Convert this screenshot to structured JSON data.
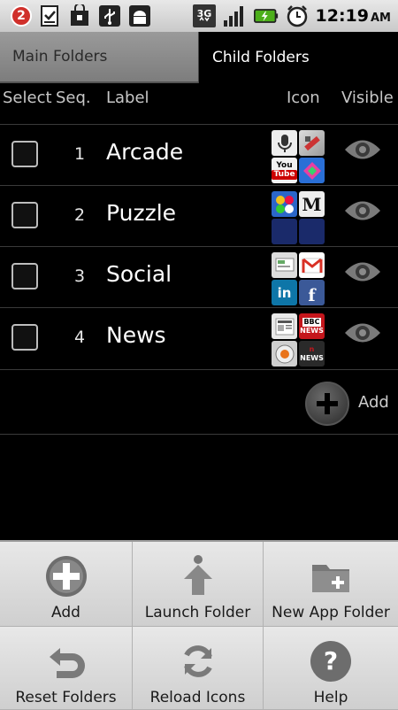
{
  "status_bar": {
    "notification_count": "2",
    "network": "3G",
    "time": "12:19",
    "ampm": "AM"
  },
  "tabs": [
    {
      "label": "Main Folders",
      "active": false
    },
    {
      "label": "Child Folders",
      "active": true
    }
  ],
  "table": {
    "headers": {
      "select": "Select",
      "seq": "Seq.",
      "label": "Label",
      "icon": "Icon",
      "visible": "Visible"
    },
    "rows": [
      {
        "seq": "1",
        "label": "Arcade"
      },
      {
        "seq": "2",
        "label": "Puzzle"
      },
      {
        "seq": "3",
        "label": "Social"
      },
      {
        "seq": "4",
        "label": "News"
      }
    ],
    "add_label": "Add"
  },
  "menu": {
    "items": [
      {
        "label": "Add",
        "icon": "plus-icon"
      },
      {
        "label": "Launch Folder",
        "icon": "arrow-up-icon"
      },
      {
        "label": "New App Folder",
        "icon": "folder-add-icon"
      },
      {
        "label": "Reset Folders",
        "icon": "undo-icon"
      },
      {
        "label": "Reload Icons",
        "icon": "refresh-icon"
      },
      {
        "label": "Help",
        "icon": "help-icon"
      }
    ]
  },
  "colors": {
    "badge": "#d0302b",
    "battery": "#4caf1a",
    "facebook": "#3b5998",
    "linkedin": "#0e76a8",
    "gmail": "#d93025",
    "news_red": "#c4161c"
  }
}
